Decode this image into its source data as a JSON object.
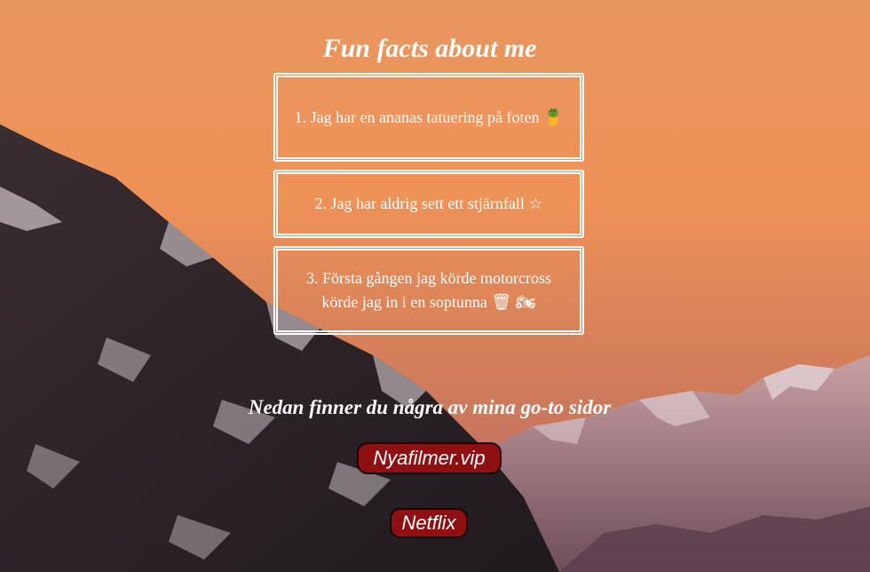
{
  "page": {
    "title": "Fun facts about me",
    "facts": [
      {
        "text": "1. Jag har en ananas tatuering på foten 🍍"
      },
      {
        "text": "2. Jag har aldrig sett ett stjärnfall ☆"
      },
      {
        "text": "3. Första gången jag körde motorcross körde jag in i en soptunna 🗑 🏍"
      }
    ],
    "links_heading": "Nedan finner du några av mina go-to sidor",
    "links": [
      {
        "label": "Nyafilmer.vip"
      },
      {
        "label": "Netflix"
      }
    ]
  },
  "colors": {
    "button_bg": "#8e1013",
    "button_border": "#1d0405",
    "text": "#ffffff",
    "sky_top": "#e8955c",
    "mountain_dark": "#2a2226"
  },
  "background": {
    "icon": "mountain-sunset-photo"
  }
}
